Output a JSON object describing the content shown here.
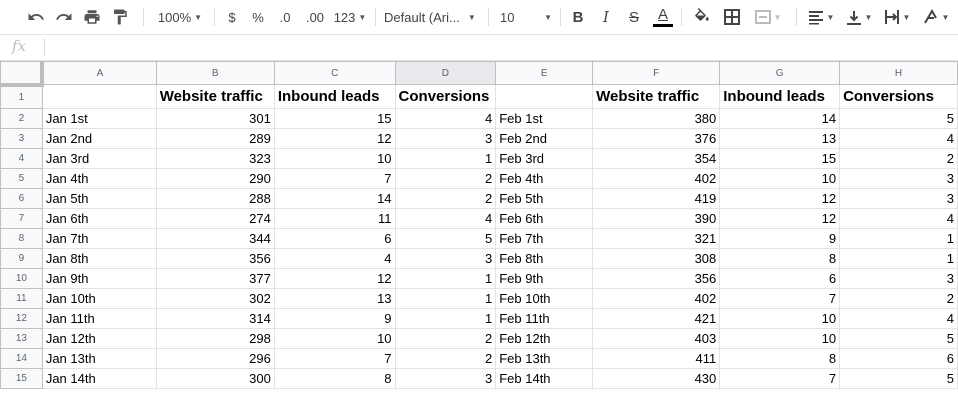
{
  "toolbar": {
    "zoom": "100%",
    "currency": "$",
    "percent": "%",
    "dec_decrease": ".0",
    "dec_increase": ".00",
    "more_formats": "123",
    "font": "Default (Ari...",
    "font_size": "10",
    "bold": "B",
    "italic": "I",
    "strike": "S",
    "text_color": "A",
    "text_color_value": "#000000"
  },
  "formula_bar": {
    "fx": "fx",
    "value": ""
  },
  "columns": [
    "A",
    "B",
    "C",
    "D",
    "E",
    "F",
    "G",
    "H"
  ],
  "selected_column": "D",
  "rows": [
    [
      "1",
      "",
      "Website traffic",
      "Inbound leads",
      "Conversions",
      "",
      "Website traffic",
      "Inbound leads",
      "Conversions"
    ],
    [
      "2",
      "Jan 1st",
      "301",
      "15",
      "4",
      "Feb 1st",
      "380",
      "14",
      "5"
    ],
    [
      "3",
      "Jan 2nd",
      "289",
      "12",
      "3",
      "Feb 2nd",
      "376",
      "13",
      "4"
    ],
    [
      "4",
      "Jan 3rd",
      "323",
      "10",
      "1",
      "Feb 3rd",
      "354",
      "15",
      "2"
    ],
    [
      "5",
      "Jan 4th",
      "290",
      "7",
      "2",
      "Feb 4th",
      "402",
      "10",
      "3"
    ],
    [
      "6",
      "Jan 5th",
      "288",
      "14",
      "2",
      "Feb 5th",
      "419",
      "12",
      "3"
    ],
    [
      "7",
      "Jan 6th",
      "274",
      "11",
      "4",
      "Feb 6th",
      "390",
      "12",
      "4"
    ],
    [
      "8",
      "Jan 7th",
      "344",
      "6",
      "5",
      "Feb 7th",
      "321",
      "9",
      "1"
    ],
    [
      "9",
      "Jan 8th",
      "356",
      "4",
      "3",
      "Feb 8th",
      "308",
      "8",
      "1"
    ],
    [
      "10",
      "Jan 9th",
      "377",
      "12",
      "1",
      "Feb 9th",
      "356",
      "6",
      "3"
    ],
    [
      "11",
      "Jan 10th",
      "302",
      "13",
      "1",
      "Feb 10th",
      "402",
      "7",
      "2"
    ],
    [
      "12",
      "Jan 11th",
      "314",
      "9",
      "1",
      "Feb 11th",
      "421",
      "10",
      "4"
    ],
    [
      "13",
      "Jan 12th",
      "298",
      "10",
      "2",
      "Feb 12th",
      "403",
      "10",
      "5"
    ],
    [
      "14",
      "Jan 13th",
      "296",
      "7",
      "2",
      "Feb 13th",
      "411",
      "8",
      "6"
    ],
    [
      "15",
      "Jan 14th",
      "300",
      "8",
      "3",
      "Feb 14th",
      "430",
      "7",
      "5"
    ]
  ]
}
